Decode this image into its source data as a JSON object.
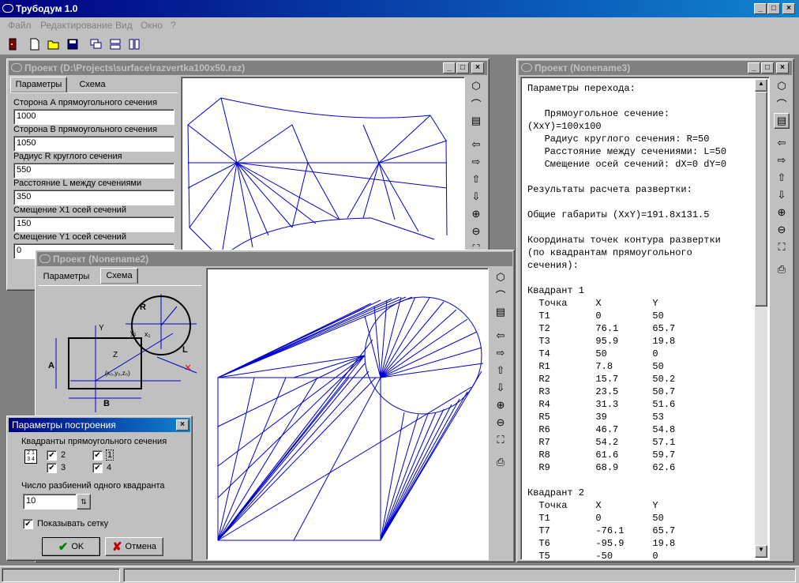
{
  "app": {
    "title": "Трубодум 1.0"
  },
  "menu": [
    "Файл",
    "Редактирование",
    "Вид",
    "Окно",
    "?"
  ],
  "win1": {
    "title": "Проект (D:\\Projects\\surface\\razvertka100x50.raz)",
    "tabs": [
      "Параметры",
      "Схема"
    ],
    "fields": [
      {
        "label": "Сторона А прямоугольного сечения",
        "value": "1000"
      },
      {
        "label": "Сторона В прямоугольного сечения",
        "value": "1050"
      },
      {
        "label": "Радиус R круглого сечения",
        "value": "550"
      },
      {
        "label": "Расстояние L между сечениями",
        "value": "350"
      },
      {
        "label": "Смещение X1 осей сечений",
        "value": "150"
      },
      {
        "label": "Смещение Y1 осей сечений",
        "value": "0"
      }
    ]
  },
  "win2": {
    "title": "Проект (Nonename2)",
    "tabs": [
      "Параметры",
      "Схема"
    ],
    "diagram": {
      "R": "R",
      "A": "A",
      "B": "B",
      "L": "L",
      "Y": "Y",
      "Z": "Z",
      "X": "X",
      "y1": "y₁",
      "x1": "x₁",
      "origin": "(x₀,y₀,z₀)"
    }
  },
  "win3": {
    "title": "Проект (Nonename3)",
    "text": "Параметры перехода:\n\n   Прямоугольное сечение:\n(XxY)=100x100\n   Радиус круглого сечения: R=50\n   Расстояние между сечениями: L=50\n   Смещение осей сечений: dX=0 dY=0\n\nРезультаты расчета развертки:\n\nОбщие габариты (XxY)=191.8x131.5\n\nКоординаты точек контура развертки\n(по квадрантам прямоугольного\nсечения):\n\nКвадрант 1\n  Точка     X         Y\n  T1        0         50\n  T2        76.1      65.7\n  T3        95.9      19.8\n  T4        50        0\n  R1        7.8       50\n  R2        15.7      50.2\n  R3        23.5      50.7\n  R4        31.3      51.6\n  R5        39        53\n  R6        46.7      54.8\n  R7        54.2      57.1\n  R8        61.6      59.7\n  R9        68.9      62.6\n\nКвадрант 2\n  Точка     X         Y\n  T1        0         50\n  T7        -76.1     65.7\n  T6        -95.9     19.8\n  T5        -50       0"
  },
  "dialog": {
    "title": "Параметры построения",
    "quadrants_label": "Квадранты прямоугольного сечения",
    "q": [
      "1",
      "2",
      "3",
      "4"
    ],
    "div_label": "Число разбиений одного квадранта",
    "div_value": "10",
    "grid_label": "Показывать сетку",
    "ok": "OK",
    "cancel": "Отмена"
  },
  "colors": {
    "accent": "#000080",
    "line": "#0000cc"
  }
}
